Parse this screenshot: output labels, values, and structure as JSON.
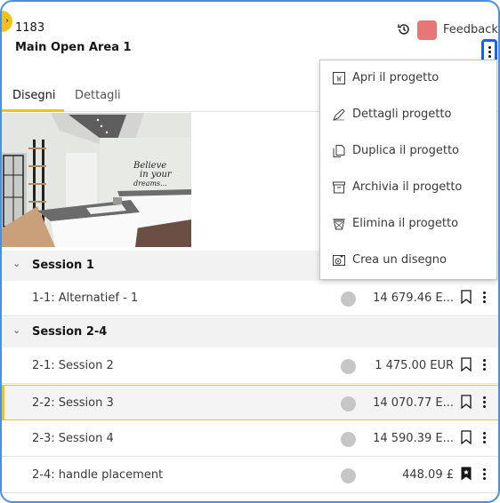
{
  "header": {
    "project_id": "1183",
    "project_name": "Main Open Area 1",
    "feedback_label": "Feedback",
    "swatch_color": "#e87676",
    "icons": {
      "expand": "chevron-right-icon",
      "history": "history-icon",
      "more": "overflow-menu-vertical-icon"
    }
  },
  "tabs": [
    {
      "label": "Disegni",
      "active": true
    },
    {
      "label": "Dettagli",
      "active": false
    }
  ],
  "thumbnail": {
    "wall_text": [
      "Believe",
      "in your",
      "dreams..."
    ]
  },
  "menu": {
    "items": [
      {
        "label": "Apri il progetto",
        "icon": "word-document-icon"
      },
      {
        "label": "Dettagli progetto",
        "icon": "pencil-icon"
      },
      {
        "label": "Duplica il progetto",
        "icon": "copy-icon"
      },
      {
        "label": "Archivia il progetto",
        "icon": "archive-icon"
      },
      {
        "label": "Elimina il progetto",
        "icon": "trash-icon"
      },
      {
        "label": "Crea un disegno",
        "icon": "add-drawing-icon"
      }
    ]
  },
  "sessions": [
    {
      "label": "Session 1",
      "rows": [
        {
          "name": "1-1: Alternatief - 1",
          "price": "14 679.46 E...",
          "bookmarked": false,
          "selected": false
        }
      ]
    },
    {
      "label": "Session 2-4",
      "rows": [
        {
          "name": "2-1: Session 2",
          "price": "1 475.00 EUR",
          "bookmarked": false,
          "selected": false
        },
        {
          "name": "2-2: Session 3",
          "price": "14 070.77 E...",
          "bookmarked": false,
          "selected": true
        },
        {
          "name": "2-3: Session 4",
          "price": "14 590.39 E...",
          "bookmarked": false,
          "selected": false
        },
        {
          "name": "2-4: handle placement",
          "price": "448.09 £",
          "bookmarked": true,
          "selected": false
        }
      ]
    }
  ],
  "colors": {
    "accent": "#f1c21b",
    "focus": "#0f62fe",
    "frame": "#4d8fd8",
    "status_dot": "#c6c6c6"
  }
}
